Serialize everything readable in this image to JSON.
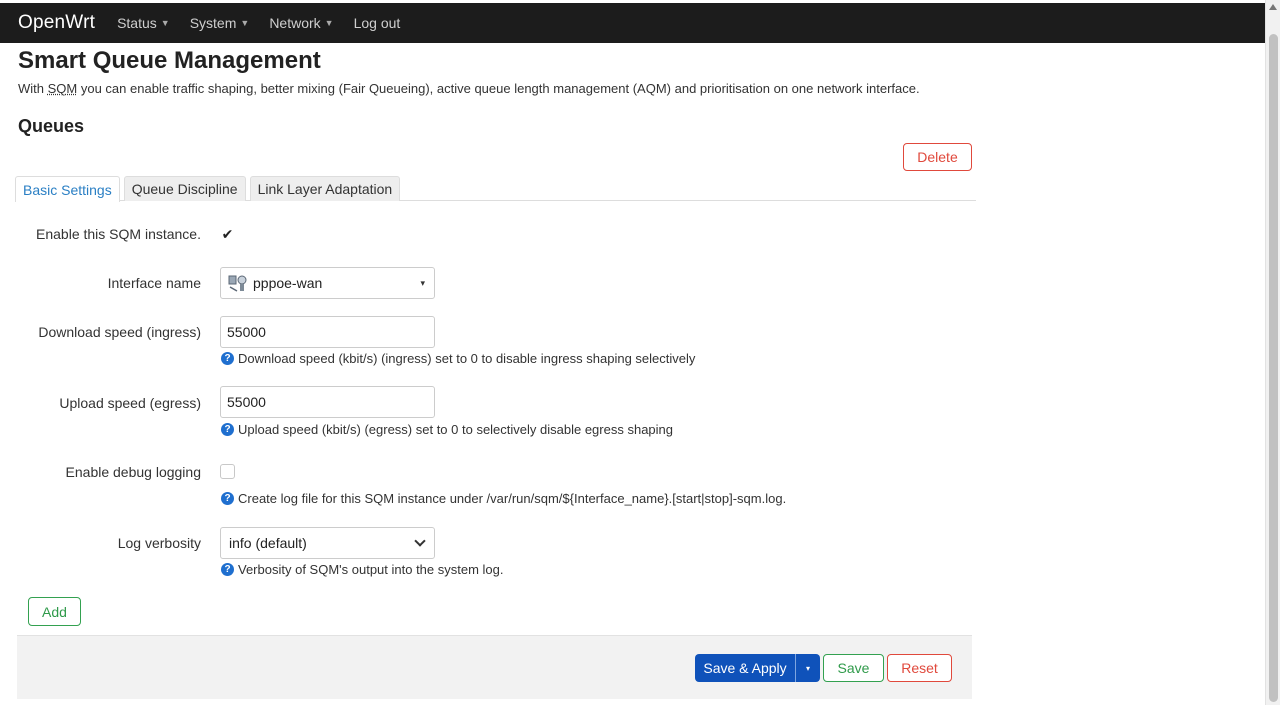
{
  "navbar": {
    "brand": "OpenWrt",
    "menus": [
      {
        "label": "Status"
      },
      {
        "label": "System"
      },
      {
        "label": "Network"
      }
    ],
    "logout": "Log out"
  },
  "page": {
    "title": "Smart Queue Management",
    "description_prefix": "With ",
    "description_abbr": "SQM",
    "description_suffix": " you can enable traffic shaping, better mixing (Fair Queueing), active queue length management (AQM) and prioritisation on one network interface."
  },
  "section": {
    "title": "Queues",
    "delete_label": "Delete",
    "tabs": [
      {
        "label": "Basic Settings",
        "active": true
      },
      {
        "label": "Queue Discipline",
        "active": false
      },
      {
        "label": "Link Layer Adaptation",
        "active": false
      }
    ]
  },
  "form": {
    "enable": {
      "label": "Enable this SQM instance.",
      "checked": true,
      "glyph": "✔"
    },
    "interface": {
      "label": "Interface name",
      "value": "pppoe-wan",
      "icon": "network-interface-icon"
    },
    "download": {
      "label": "Download speed (ingress)",
      "value": "55000",
      "help": "Download speed (kbit/s) (ingress) set to 0 to disable ingress shaping selectively"
    },
    "upload": {
      "label": "Upload speed (egress)",
      "value": "55000",
      "help": "Upload speed (kbit/s) (egress) set to 0 to selectively disable egress shaping"
    },
    "debug": {
      "label": "Enable debug logging",
      "checked": false,
      "help": "Create log file for this SQM instance under /var/run/sqm/${Interface_name}.[start|stop]-sqm.log."
    },
    "verbosity": {
      "label": "Log verbosity",
      "value": "info (default)",
      "help": "Verbosity of SQM's output into the system log."
    }
  },
  "add_label": "Add",
  "actions": {
    "save_apply": "Save & Apply",
    "save": "Save",
    "reset": "Reset"
  },
  "help_glyph": "?",
  "dropdown_glyph": "▾",
  "colors": {
    "navbar": "#1c1c1c",
    "primary": "#0f52ba",
    "positive": "#33a150",
    "negative": "#e0493c",
    "link": "#2a7fc4"
  }
}
